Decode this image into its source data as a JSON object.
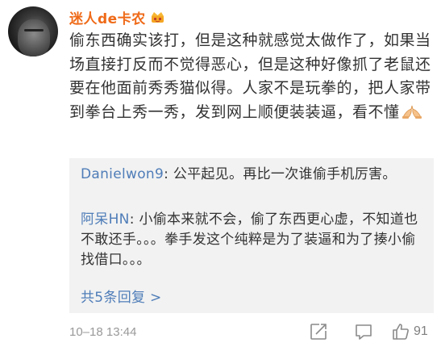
{
  "comment": {
    "username": "迷人de卡农",
    "text": "偷东西确实该打，但是这种就感觉太做作了，如果当场直接打反而不觉得恶心，但是这种好像抓了老鼠还要在他面前秀秀猫似得。人家不是玩拳的，把人家带到拳台上秀一秀，发到网上顺便装装逼，看不懂",
    "timestamp": "10–18 13:44",
    "likes": "91",
    "icons": [
      "vip-crown-icon",
      "folded-hands-emoji-icon",
      "share-icon",
      "comment-icon",
      "like-thumb-icon"
    ]
  },
  "replies": [
    {
      "name": "Danielwon9",
      "text": "公平起见。再比一次谁偷手机厉害。"
    },
    {
      "name": "阿呆HN",
      "text": "小偷本来就不会，偷了东西更心虚，不知道也不敢还手。。。拳手发这个纯粹是为了装逼和为了揍小偷找借口。。。"
    }
  ],
  "more_replies": "共5条回复 >",
  "colors": {
    "username": "#ef6a18",
    "link": "#4f7db8",
    "reply_bg": "#f2f2f2",
    "meta": "#999999"
  }
}
